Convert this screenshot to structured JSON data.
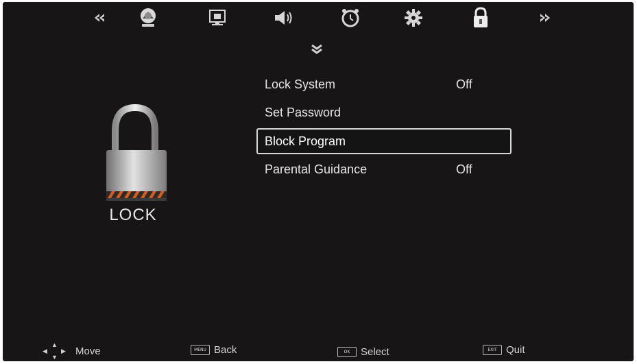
{
  "top_menu": {
    "items": [
      {
        "name": "prev-arrow-icon"
      },
      {
        "name": "picture-icon"
      },
      {
        "name": "channel-icon"
      },
      {
        "name": "sound-icon"
      },
      {
        "name": "time-icon"
      },
      {
        "name": "setup-icon"
      },
      {
        "name": "lock-icon",
        "active": true
      },
      {
        "name": "next-arrow-icon"
      }
    ]
  },
  "left_panel": {
    "caption": "LOCK"
  },
  "menu": {
    "items": [
      {
        "label": "Lock System",
        "value": "Off"
      },
      {
        "label": "Set Password",
        "value": ""
      },
      {
        "label": "Block Program",
        "value": "",
        "selected": true
      },
      {
        "label": "Parental Guidance",
        "value": "Off"
      }
    ]
  },
  "footer": {
    "move": "Move",
    "back": "Back",
    "back_key": "MENU",
    "select": "Select",
    "select_key": "OK",
    "quit": "Quit",
    "quit_key": "EXIT"
  },
  "colors": {
    "background": "#171515",
    "text": "#e6e6e6",
    "highlight_border": "#d8d8d8",
    "lock_stripe_orange": "#d85a1a"
  }
}
